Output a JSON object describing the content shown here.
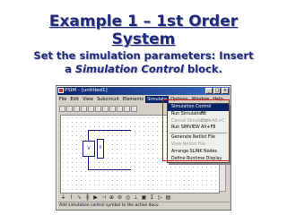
{
  "slide": {
    "title_line1": "Example 1 – 1st Order",
    "title_line2": "System",
    "subtitle_line1": "Set the simulation parameters: Insert",
    "subtitle_pre": "a ",
    "subtitle_em": "Simulation Control",
    "subtitle_post": "  block."
  },
  "window": {
    "title": "PSIM - [untitled1]",
    "menu": [
      "File",
      "Edit",
      "View",
      "Subcircuit",
      "Elements",
      "Simulate",
      "Options",
      "Window",
      "Help"
    ],
    "active_menu_index": 5,
    "status_text": "Add simulation control symbol to the active docu",
    "canvas_labels": {
      "block_v": "V",
      "block_r": "R"
    }
  },
  "dropdown": {
    "items": [
      {
        "label": "Simulation Control",
        "shortcut": "",
        "state": "selected"
      },
      {
        "label": "Run Simulation",
        "shortcut": "F8",
        "state": "normal"
      },
      {
        "label": "Cancel Simulation",
        "shortcut": "Ctrl+Alt+C",
        "state": "disabled"
      },
      {
        "label": "Run SIMVIEW",
        "shortcut": "Alt+F8",
        "state": "normal"
      },
      {
        "label": "Generate Netlist File",
        "shortcut": "",
        "state": "normal"
      },
      {
        "label": "View Netlist File",
        "shortcut": "",
        "state": "disabled"
      },
      {
        "label": "Arrange SLINK Nodes",
        "shortcut": "",
        "state": "normal"
      },
      {
        "label": "Define Runtime Display",
        "shortcut": "",
        "state": "normal"
      }
    ]
  },
  "colors": {
    "title": "#1f2a7a",
    "menu_highlight": "#0a246a",
    "annotation_box": "#d01010"
  }
}
